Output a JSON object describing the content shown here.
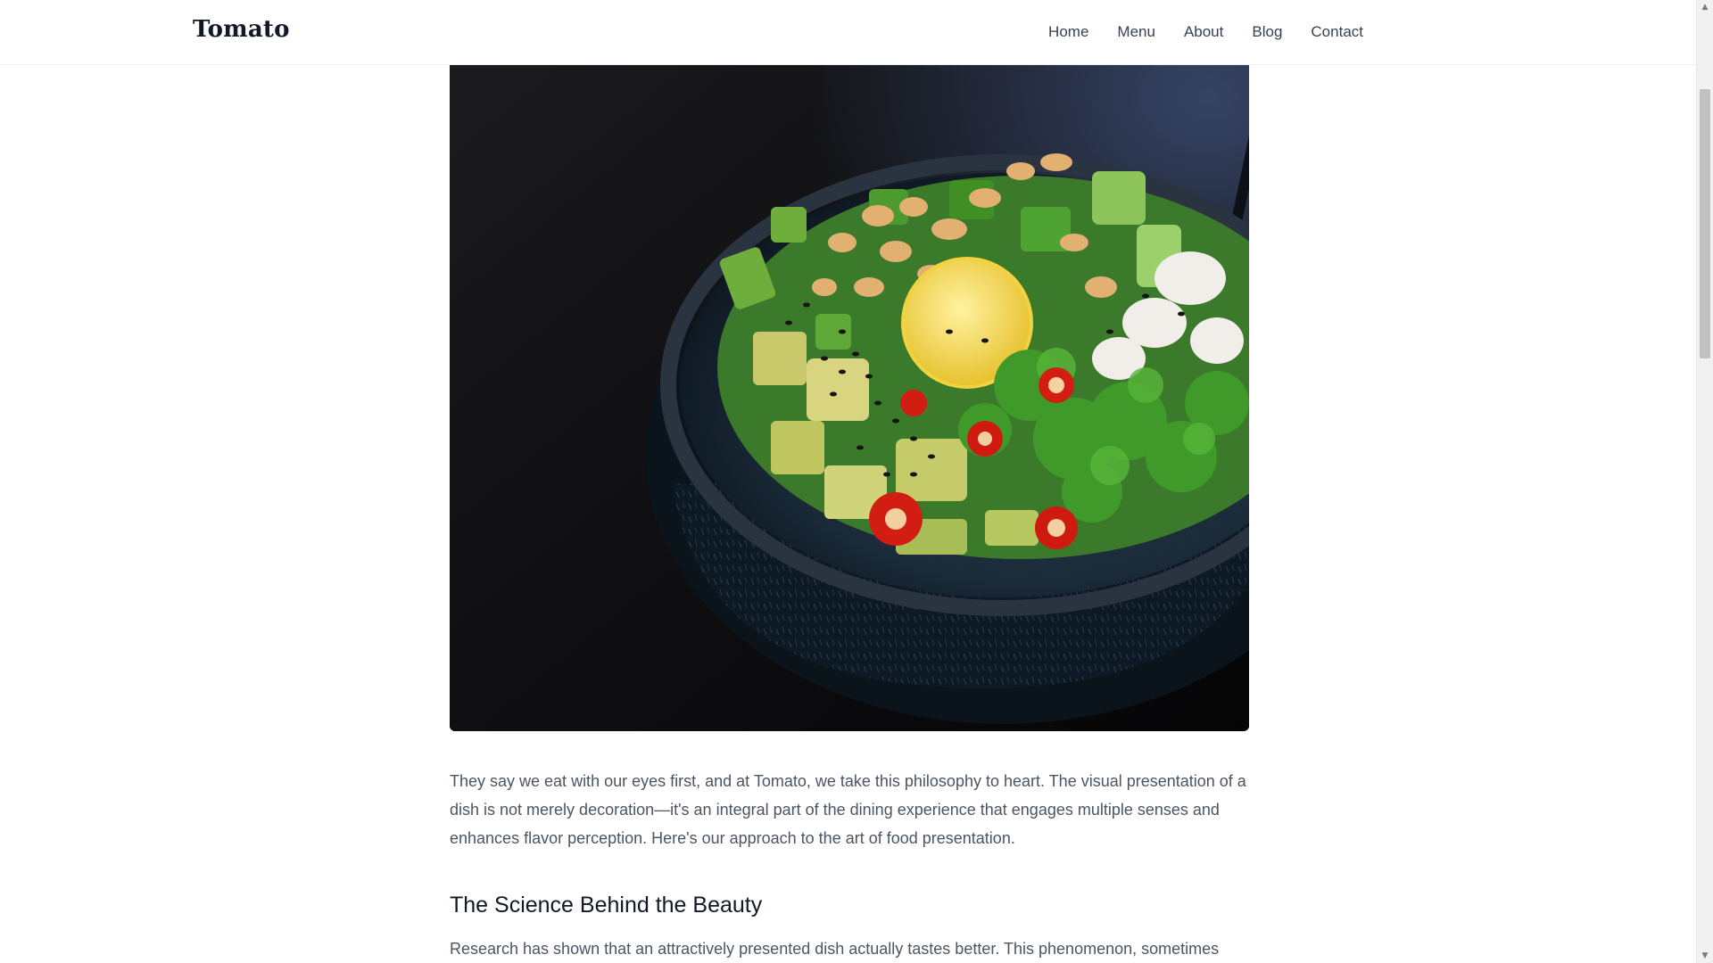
{
  "site": {
    "logo": "Tomato"
  },
  "nav": {
    "items": [
      {
        "label": "Home"
      },
      {
        "label": "Menu"
      },
      {
        "label": "About"
      },
      {
        "label": "Blog"
      },
      {
        "label": "Contact"
      }
    ]
  },
  "hero": {
    "icon": "salad-bowl-photo"
  },
  "article": {
    "intro": "They say we eat with our eyes first, and at Tomato, we take this philosophy to heart. The visual presentation of a dish is not merely decoration—it's an integral part of the dining experience that engages multiple senses and enhances flavor perception. Here's our approach to the art of food presentation.",
    "section_heading": "The Science Behind the Beauty",
    "section_text": "Research has shown that an attractively presented dish actually tastes better. This phenomenon, sometimes"
  },
  "scrollbar": {
    "up_glyph": "▲",
    "down_glyph": "▼"
  }
}
